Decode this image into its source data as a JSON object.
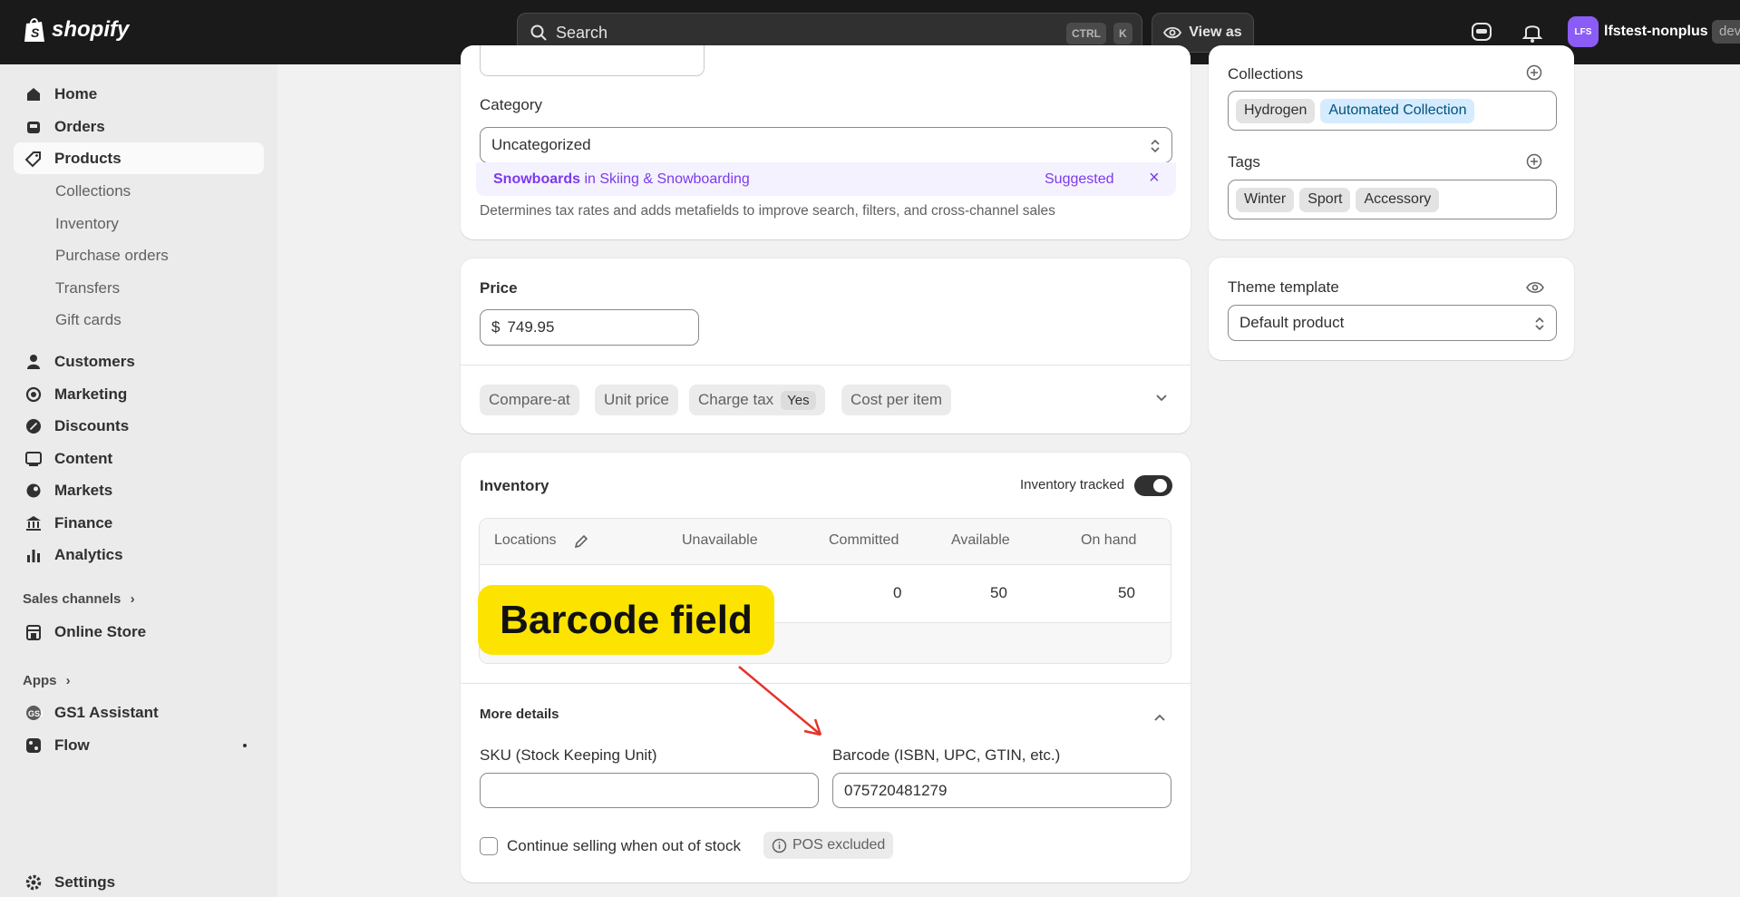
{
  "topbar": {
    "logo_text": "shopify",
    "search_placeholder": "Search",
    "kbd_ctrl": "CTRL",
    "kbd_k": "K",
    "view_as_label": "View as",
    "avatar_initials": "LFS",
    "store_name": "lfstest-nonplus",
    "store_badge": "dev"
  },
  "sidebar": {
    "main_items": [
      "Home",
      "Orders",
      "Products"
    ],
    "product_sub_items": [
      "Collections",
      "Inventory",
      "Purchase orders",
      "Transfers",
      "Gift cards"
    ],
    "other_items": [
      "Customers",
      "Marketing",
      "Discounts",
      "Content",
      "Markets",
      "Finance",
      "Analytics"
    ],
    "sales_channels_label": "Sales channels",
    "online_store": "Online Store",
    "apps_label": "Apps",
    "gs1": "GS1 Assistant",
    "flow": "Flow",
    "settings": "Settings"
  },
  "category": {
    "label": "Category",
    "value": "Uncategorized",
    "suggestion_name": "Snowboards",
    "suggestion_path": " in Skiing & Snowboarding",
    "suggested_label": "Suggested",
    "help": "Determines tax rates and adds metafields to improve search, filters, and cross-channel sales"
  },
  "price": {
    "label": "Price",
    "currency": "$",
    "value": "749.95",
    "pills": {
      "compare_at": "Compare-at",
      "unit_price": "Unit price",
      "charge_tax": "Charge tax",
      "charge_tax_value": "Yes",
      "cost_per_item": "Cost per item"
    }
  },
  "inventory": {
    "title": "Inventory",
    "tracked_label": "Inventory tracked",
    "tracked": true,
    "columns": [
      "Locations",
      "Unavailable",
      "Committed",
      "Available",
      "On hand"
    ],
    "row": {
      "committed": "0",
      "available": "50",
      "on_hand": "50"
    },
    "more_details": "More details",
    "sku_label": "SKU (Stock Keeping Unit)",
    "sku_value": "",
    "barcode_label": "Barcode (ISBN, UPC, GTIN, etc.)",
    "barcode_value": "075720481279",
    "continue_selling": "Continue selling when out of stock",
    "pos_excluded": "POS excluded"
  },
  "right": {
    "collections_label": "Collections",
    "collections": [
      "Hydrogen",
      "Automated Collection"
    ],
    "tags_label": "Tags",
    "tags": [
      "Winter",
      "Sport",
      "Accessory"
    ],
    "theme_label": "Theme template",
    "theme_value": "Default product"
  },
  "annotation": {
    "text": "Barcode field",
    "color": "#fce400",
    "arrow_color": "#e5332a"
  }
}
